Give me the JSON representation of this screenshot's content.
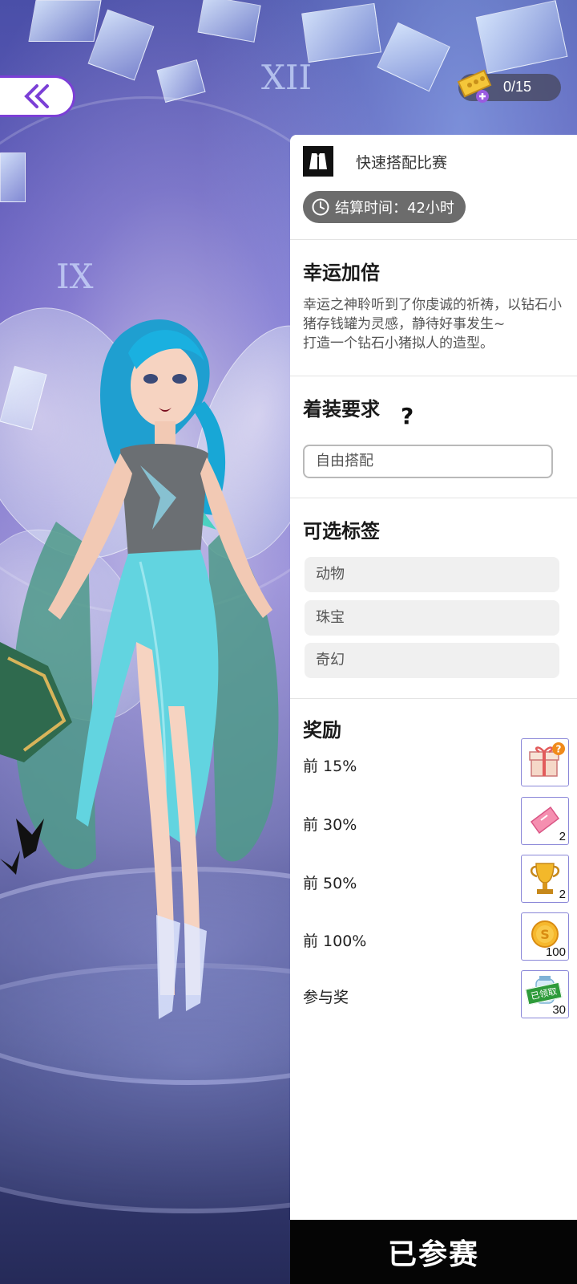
{
  "ticket": {
    "count": "0/15",
    "icon": "ticket-icon"
  },
  "contest": {
    "name": "快速搭配比赛",
    "icon": "outfit-icon"
  },
  "timer": {
    "label": "结算时间：42小时",
    "icon": "clock-icon"
  },
  "theme": {
    "title": "幸运加倍",
    "description": "幸运之神聆听到了你虔诚的祈祷，以钻石小猪存钱罐为灵感，静待好事发生~\n打造一个钻石小猪拟人的造型。"
  },
  "dress_code": {
    "title": "着装要求",
    "help_icon": "?",
    "value": "自由搭配"
  },
  "tags": {
    "title": "可选标签",
    "items": [
      "动物",
      "珠宝",
      "奇幻"
    ]
  },
  "rewards": {
    "title": "奖励",
    "items": [
      {
        "label": "前 15%",
        "icon": "mystery-gift-icon",
        "count": ""
      },
      {
        "label": "前 30%",
        "icon": "pink-ticket-icon",
        "count": "2"
      },
      {
        "label": "前 50%",
        "icon": "trophy-icon",
        "count": "2"
      },
      {
        "label": "前 100%",
        "icon": "gold-coin-icon",
        "count": "100"
      },
      {
        "label": "参与奖",
        "icon": "potion-icon",
        "count": "30",
        "badge": "已领取"
      }
    ]
  },
  "join_button": {
    "label": "已参赛"
  },
  "colors": {
    "accent": "#7b3fd6",
    "panel_bg": "#ffffff",
    "timer_bg": "#6c6c6c",
    "button_bg": "#050505"
  }
}
